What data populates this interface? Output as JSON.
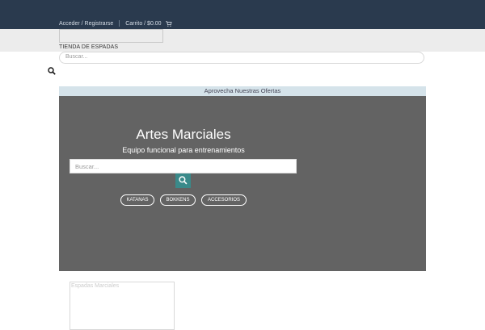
{
  "header": {
    "login_label": "Acceder / Registrarse",
    "cart_label": "Carrito / $0.00",
    "cart_icon": "cart-icon"
  },
  "branding": {
    "store_name": "TIENDA DE ESPADAS"
  },
  "search": {
    "placeholder": "Buscar...",
    "icon": "search-icon"
  },
  "banner": {
    "offer_text": "Aprovecha Nuestras Ofertas"
  },
  "hero": {
    "title": "Artes Marciales",
    "subtitle": "Equipo funcional para entrenamientos",
    "search_placeholder": "Buscar...",
    "categories": [
      {
        "label": "KATANAS"
      },
      {
        "label": "BOKKENS"
      },
      {
        "label": "ACCESORIOS"
      }
    ]
  },
  "sidebar": {
    "box_label": "Espadas Marciales"
  },
  "colors": {
    "topbar": "#2a3a4e",
    "hero_bg": "#636363",
    "offer_bg": "#d5e3ea",
    "search_button": "#3a8a8a"
  }
}
